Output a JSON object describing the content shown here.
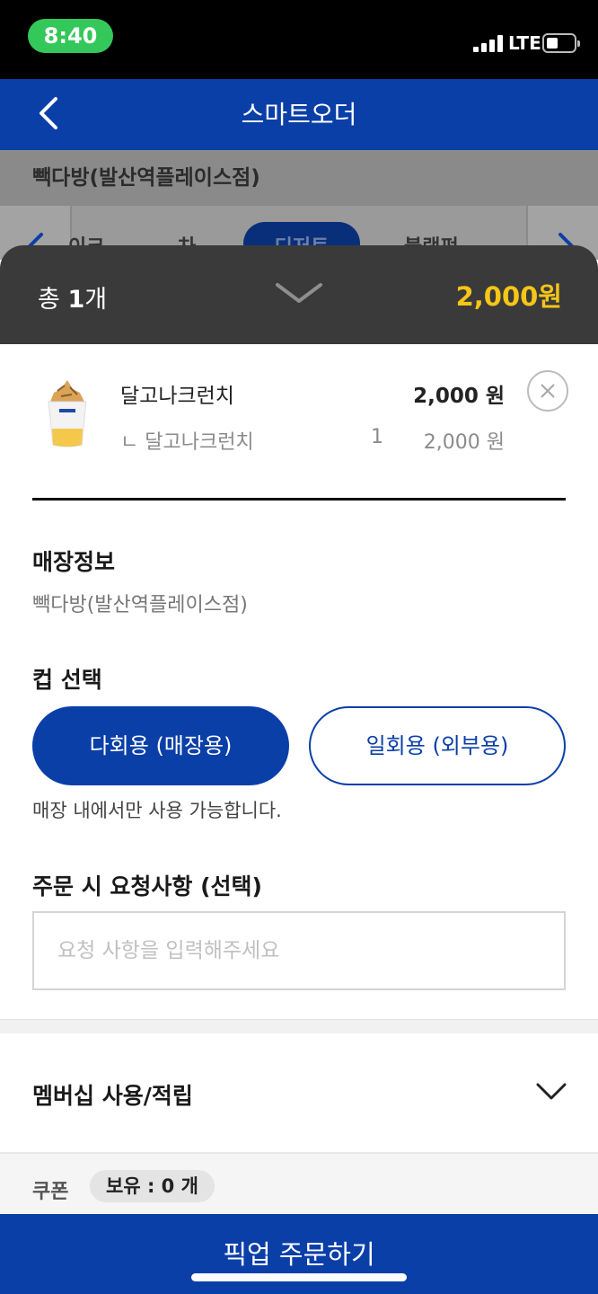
{
  "status_bar": {
    "time": "8:40",
    "network": "LTE"
  },
  "header": {
    "title": "스마트오더"
  },
  "store_bar": {
    "name": "빽다방(발산역플레이스점)"
  },
  "categories": {
    "items": [
      "이크",
      "차",
      "디저트",
      "블랙펀"
    ],
    "active_index": 2
  },
  "summary": {
    "count_prefix": "총 ",
    "count_value": "1",
    "count_suffix": "개",
    "total": "2,000원"
  },
  "cart": {
    "items": [
      {
        "name": "달고나크런치",
        "price": "2,000 원",
        "option_name": "ㄴ 달고나크런치",
        "option_qty": "1",
        "option_price": "2,000 원",
        "thumbnail_icon": "dalgona-crunch-cup-icon"
      }
    ]
  },
  "store_info": {
    "title": "매장정보",
    "value": "빽다방(발산역플레이스점)"
  },
  "cup_select": {
    "title": "컵 선택",
    "options": [
      "다회용 (매장용)",
      "일회용 (외부용)"
    ],
    "selected_index": 0,
    "note": "매장 내에서만 사용 가능합니다."
  },
  "request": {
    "title": "주문 시 요청사항 (선택)",
    "placeholder": "요청 사항을 입력해주세요",
    "value": ""
  },
  "membership": {
    "title": "멤버십 사용/적립"
  },
  "coupon": {
    "label": "쿠폰",
    "badge": "보유 : 0 개"
  },
  "order_button": {
    "label": "픽업 주문하기"
  },
  "colors": {
    "brand_blue": "#0b3fa8",
    "total_yellow": "#f5c518",
    "summary_bg": "#3a3a3a",
    "status_green": "#34c759"
  }
}
